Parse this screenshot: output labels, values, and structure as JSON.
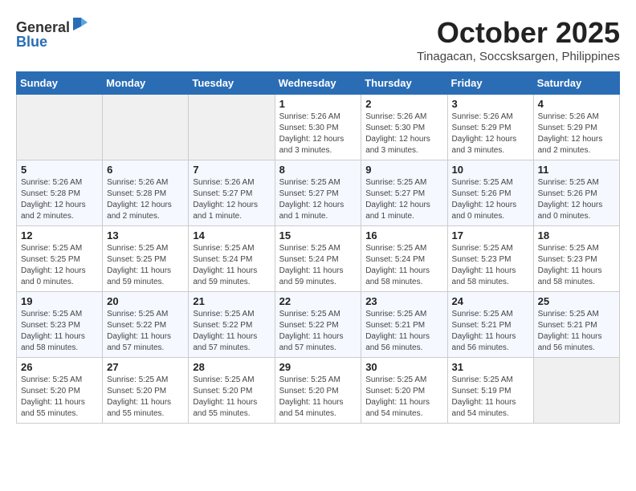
{
  "header": {
    "logo_general": "General",
    "logo_blue": "Blue",
    "month": "October 2025",
    "location": "Tinagacan, Soccsksargen, Philippines"
  },
  "weekdays": [
    "Sunday",
    "Monday",
    "Tuesday",
    "Wednesday",
    "Thursday",
    "Friday",
    "Saturday"
  ],
  "weeks": [
    [
      {
        "day": "",
        "sunrise": "",
        "sunset": "",
        "daylight": ""
      },
      {
        "day": "",
        "sunrise": "",
        "sunset": "",
        "daylight": ""
      },
      {
        "day": "",
        "sunrise": "",
        "sunset": "",
        "daylight": ""
      },
      {
        "day": "1",
        "sunrise": "Sunrise: 5:26 AM",
        "sunset": "Sunset: 5:30 PM",
        "daylight": "Daylight: 12 hours and 3 minutes."
      },
      {
        "day": "2",
        "sunrise": "Sunrise: 5:26 AM",
        "sunset": "Sunset: 5:30 PM",
        "daylight": "Daylight: 12 hours and 3 minutes."
      },
      {
        "day": "3",
        "sunrise": "Sunrise: 5:26 AM",
        "sunset": "Sunset: 5:29 PM",
        "daylight": "Daylight: 12 hours and 3 minutes."
      },
      {
        "day": "4",
        "sunrise": "Sunrise: 5:26 AM",
        "sunset": "Sunset: 5:29 PM",
        "daylight": "Daylight: 12 hours and 2 minutes."
      }
    ],
    [
      {
        "day": "5",
        "sunrise": "Sunrise: 5:26 AM",
        "sunset": "Sunset: 5:28 PM",
        "daylight": "Daylight: 12 hours and 2 minutes."
      },
      {
        "day": "6",
        "sunrise": "Sunrise: 5:26 AM",
        "sunset": "Sunset: 5:28 PM",
        "daylight": "Daylight: 12 hours and 2 minutes."
      },
      {
        "day": "7",
        "sunrise": "Sunrise: 5:26 AM",
        "sunset": "Sunset: 5:27 PM",
        "daylight": "Daylight: 12 hours and 1 minute."
      },
      {
        "day": "8",
        "sunrise": "Sunrise: 5:25 AM",
        "sunset": "Sunset: 5:27 PM",
        "daylight": "Daylight: 12 hours and 1 minute."
      },
      {
        "day": "9",
        "sunrise": "Sunrise: 5:25 AM",
        "sunset": "Sunset: 5:27 PM",
        "daylight": "Daylight: 12 hours and 1 minute."
      },
      {
        "day": "10",
        "sunrise": "Sunrise: 5:25 AM",
        "sunset": "Sunset: 5:26 PM",
        "daylight": "Daylight: 12 hours and 0 minutes."
      },
      {
        "day": "11",
        "sunrise": "Sunrise: 5:25 AM",
        "sunset": "Sunset: 5:26 PM",
        "daylight": "Daylight: 12 hours and 0 minutes."
      }
    ],
    [
      {
        "day": "12",
        "sunrise": "Sunrise: 5:25 AM",
        "sunset": "Sunset: 5:25 PM",
        "daylight": "Daylight: 12 hours and 0 minutes."
      },
      {
        "day": "13",
        "sunrise": "Sunrise: 5:25 AM",
        "sunset": "Sunset: 5:25 PM",
        "daylight": "Daylight: 11 hours and 59 minutes."
      },
      {
        "day": "14",
        "sunrise": "Sunrise: 5:25 AM",
        "sunset": "Sunset: 5:24 PM",
        "daylight": "Daylight: 11 hours and 59 minutes."
      },
      {
        "day": "15",
        "sunrise": "Sunrise: 5:25 AM",
        "sunset": "Sunset: 5:24 PM",
        "daylight": "Daylight: 11 hours and 59 minutes."
      },
      {
        "day": "16",
        "sunrise": "Sunrise: 5:25 AM",
        "sunset": "Sunset: 5:24 PM",
        "daylight": "Daylight: 11 hours and 58 minutes."
      },
      {
        "day": "17",
        "sunrise": "Sunrise: 5:25 AM",
        "sunset": "Sunset: 5:23 PM",
        "daylight": "Daylight: 11 hours and 58 minutes."
      },
      {
        "day": "18",
        "sunrise": "Sunrise: 5:25 AM",
        "sunset": "Sunset: 5:23 PM",
        "daylight": "Daylight: 11 hours and 58 minutes."
      }
    ],
    [
      {
        "day": "19",
        "sunrise": "Sunrise: 5:25 AM",
        "sunset": "Sunset: 5:23 PM",
        "daylight": "Daylight: 11 hours and 58 minutes."
      },
      {
        "day": "20",
        "sunrise": "Sunrise: 5:25 AM",
        "sunset": "Sunset: 5:22 PM",
        "daylight": "Daylight: 11 hours and 57 minutes."
      },
      {
        "day": "21",
        "sunrise": "Sunrise: 5:25 AM",
        "sunset": "Sunset: 5:22 PM",
        "daylight": "Daylight: 11 hours and 57 minutes."
      },
      {
        "day": "22",
        "sunrise": "Sunrise: 5:25 AM",
        "sunset": "Sunset: 5:22 PM",
        "daylight": "Daylight: 11 hours and 57 minutes."
      },
      {
        "day": "23",
        "sunrise": "Sunrise: 5:25 AM",
        "sunset": "Sunset: 5:21 PM",
        "daylight": "Daylight: 11 hours and 56 minutes."
      },
      {
        "day": "24",
        "sunrise": "Sunrise: 5:25 AM",
        "sunset": "Sunset: 5:21 PM",
        "daylight": "Daylight: 11 hours and 56 minutes."
      },
      {
        "day": "25",
        "sunrise": "Sunrise: 5:25 AM",
        "sunset": "Sunset: 5:21 PM",
        "daylight": "Daylight: 11 hours and 56 minutes."
      }
    ],
    [
      {
        "day": "26",
        "sunrise": "Sunrise: 5:25 AM",
        "sunset": "Sunset: 5:20 PM",
        "daylight": "Daylight: 11 hours and 55 minutes."
      },
      {
        "day": "27",
        "sunrise": "Sunrise: 5:25 AM",
        "sunset": "Sunset: 5:20 PM",
        "daylight": "Daylight: 11 hours and 55 minutes."
      },
      {
        "day": "28",
        "sunrise": "Sunrise: 5:25 AM",
        "sunset": "Sunset: 5:20 PM",
        "daylight": "Daylight: 11 hours and 55 minutes."
      },
      {
        "day": "29",
        "sunrise": "Sunrise: 5:25 AM",
        "sunset": "Sunset: 5:20 PM",
        "daylight": "Daylight: 11 hours and 54 minutes."
      },
      {
        "day": "30",
        "sunrise": "Sunrise: 5:25 AM",
        "sunset": "Sunset: 5:20 PM",
        "daylight": "Daylight: 11 hours and 54 minutes."
      },
      {
        "day": "31",
        "sunrise": "Sunrise: 5:25 AM",
        "sunset": "Sunset: 5:19 PM",
        "daylight": "Daylight: 11 hours and 54 minutes."
      },
      {
        "day": "",
        "sunrise": "",
        "sunset": "",
        "daylight": ""
      }
    ]
  ]
}
